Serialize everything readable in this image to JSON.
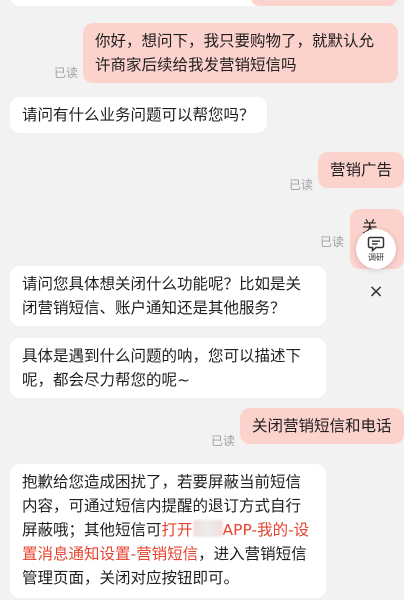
{
  "messages": [
    {
      "side": "out",
      "text": "你好，想问下，我只要购物了，就默认允许商家后续给我发营销短信吗",
      "read": "已读"
    },
    {
      "side": "in",
      "text": "请问有什么业务问题可以帮您吗？"
    },
    {
      "side": "out",
      "text": "营销广告",
      "read": "已读"
    },
    {
      "side": "out",
      "text": "关闭",
      "read": "已读"
    },
    {
      "side": "in",
      "text": "请问您具体想关闭什么功能呢？比如是关闭营销短信、账户通知还是其他服务？"
    },
    {
      "side": "in",
      "text": "具体是遇到什么问题的呐，您可以描述下呢，都会尽力帮您的呢~"
    },
    {
      "side": "out",
      "text": "关闭营销短信和电话",
      "read": "已读"
    },
    {
      "side": "in",
      "text_before": "抱歉给您造成困扰了，若要屏蔽当前短信内容，可通过短信内提醒的退订方式自行屏蔽哦；其他短信可",
      "link_prefix": "打开",
      "link_suffix": "APP-我的-设置消息通知设置-营销短信",
      "text_after": "，进入营销短信管理页面，关闭对应按钮即可。"
    }
  ],
  "floating_button": {
    "label": "调研",
    "icon": "survey-chat-icon"
  },
  "close_icon": "×",
  "colors": {
    "outgoing_bubble": "#fcd2cc",
    "incoming_bubble": "#ffffff",
    "background": "#f2f2f2",
    "link": "#e8432f",
    "read_receipt": "#a0a0a0"
  }
}
